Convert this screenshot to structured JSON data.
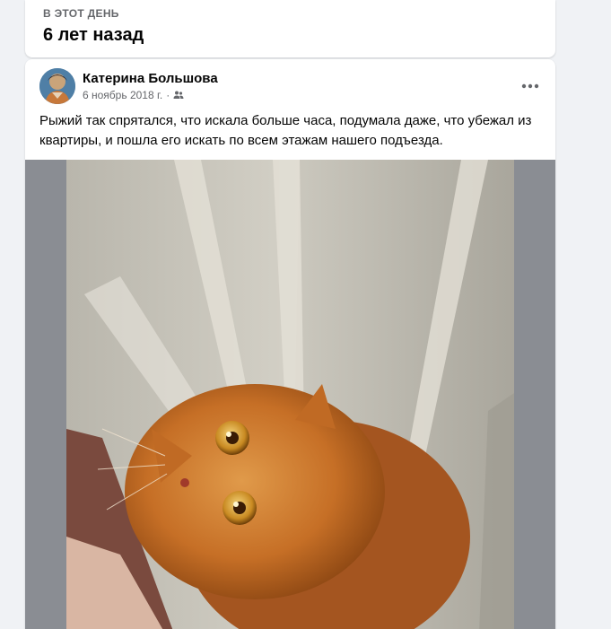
{
  "memory": {
    "section_label": "В ЭТОТ ДЕНЬ",
    "years_ago": "6 лет назад"
  },
  "post": {
    "author": "Катерина Большова",
    "date": "6 ноябрь 2018 г.",
    "separator": "·",
    "audience_icon": "friends-icon",
    "more_icon": "more-horizontal-icon",
    "text": "Рыжий так спрятался, что искала больше часа, подумала даже, что убежал из квартиры, и пошла его искать по всем этажам нашего подъезда.",
    "photo_icon": "cat-photo"
  },
  "colors": {
    "background": "#f0f2f5",
    "card": "#ffffff",
    "secondary_text": "#65676b",
    "primary_text": "#050505",
    "photo_frame": "#8a8d93"
  }
}
